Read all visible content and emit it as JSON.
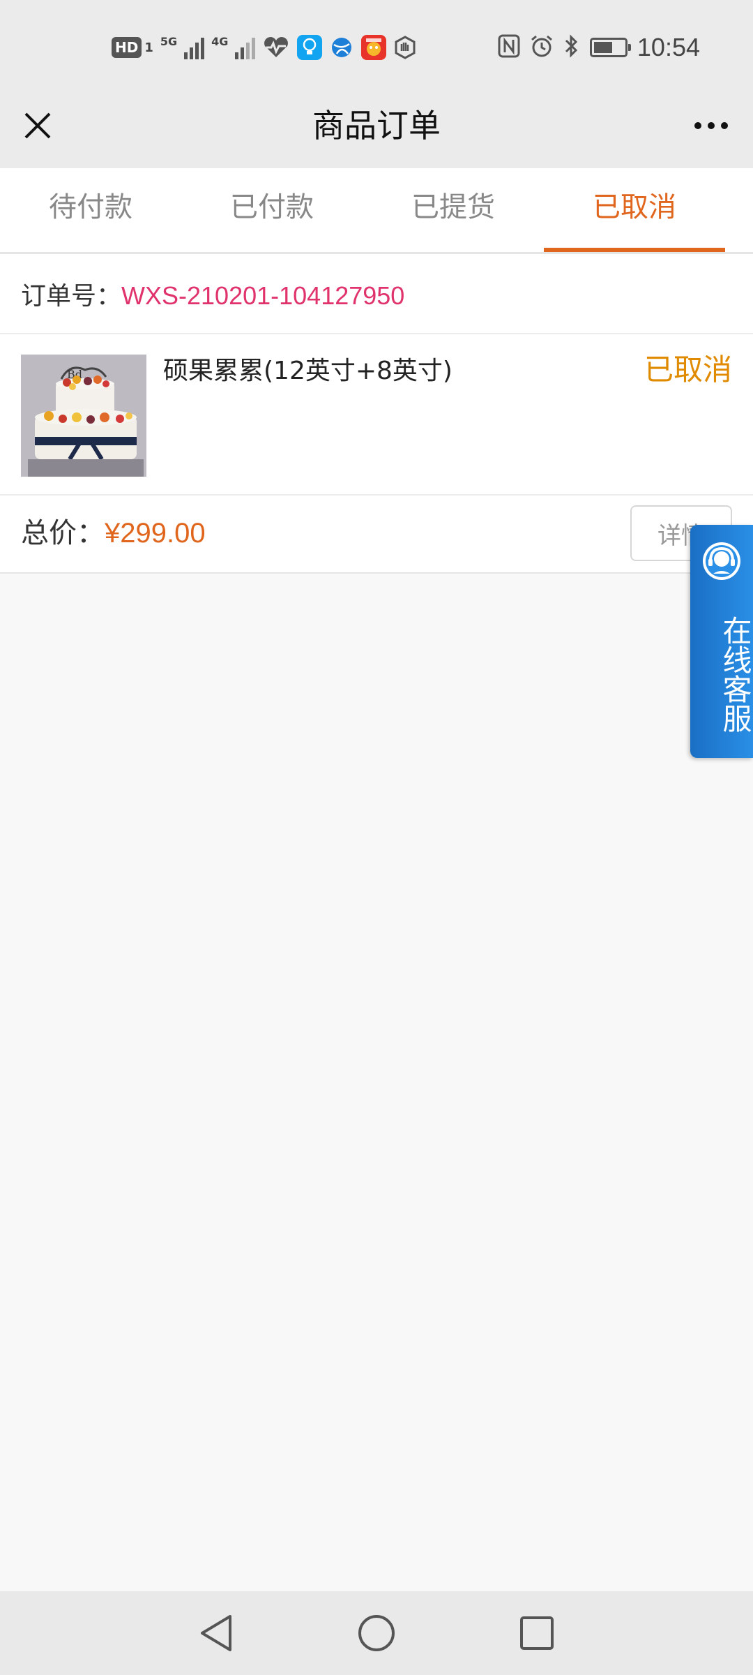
{
  "status_bar": {
    "hd_label": "HD",
    "sim1_label": "1",
    "net1_label": "5G",
    "net2_label": "4G",
    "time": "10:54",
    "battery_level": 0.55
  },
  "header": {
    "title": "商品订单"
  },
  "tabs": [
    {
      "label": "待付款",
      "active": false
    },
    {
      "label": "已付款",
      "active": false
    },
    {
      "label": "已提货",
      "active": false
    },
    {
      "label": "已取消",
      "active": true
    }
  ],
  "order": {
    "order_no_label": "订单号：",
    "order_no_value": "WXS-210201-104127950",
    "product_name": "硕果累累(12英寸+8英寸)",
    "status": "已取消",
    "total_label": "总价：",
    "total_value": "¥299.00",
    "detail_button": "详情"
  },
  "customer_service": {
    "label": "在线客服"
  },
  "colors": {
    "accent": "#e0661e",
    "order_no": "#e0336c",
    "status": "#e08a00",
    "cs_blue": "#2a8fe6"
  }
}
